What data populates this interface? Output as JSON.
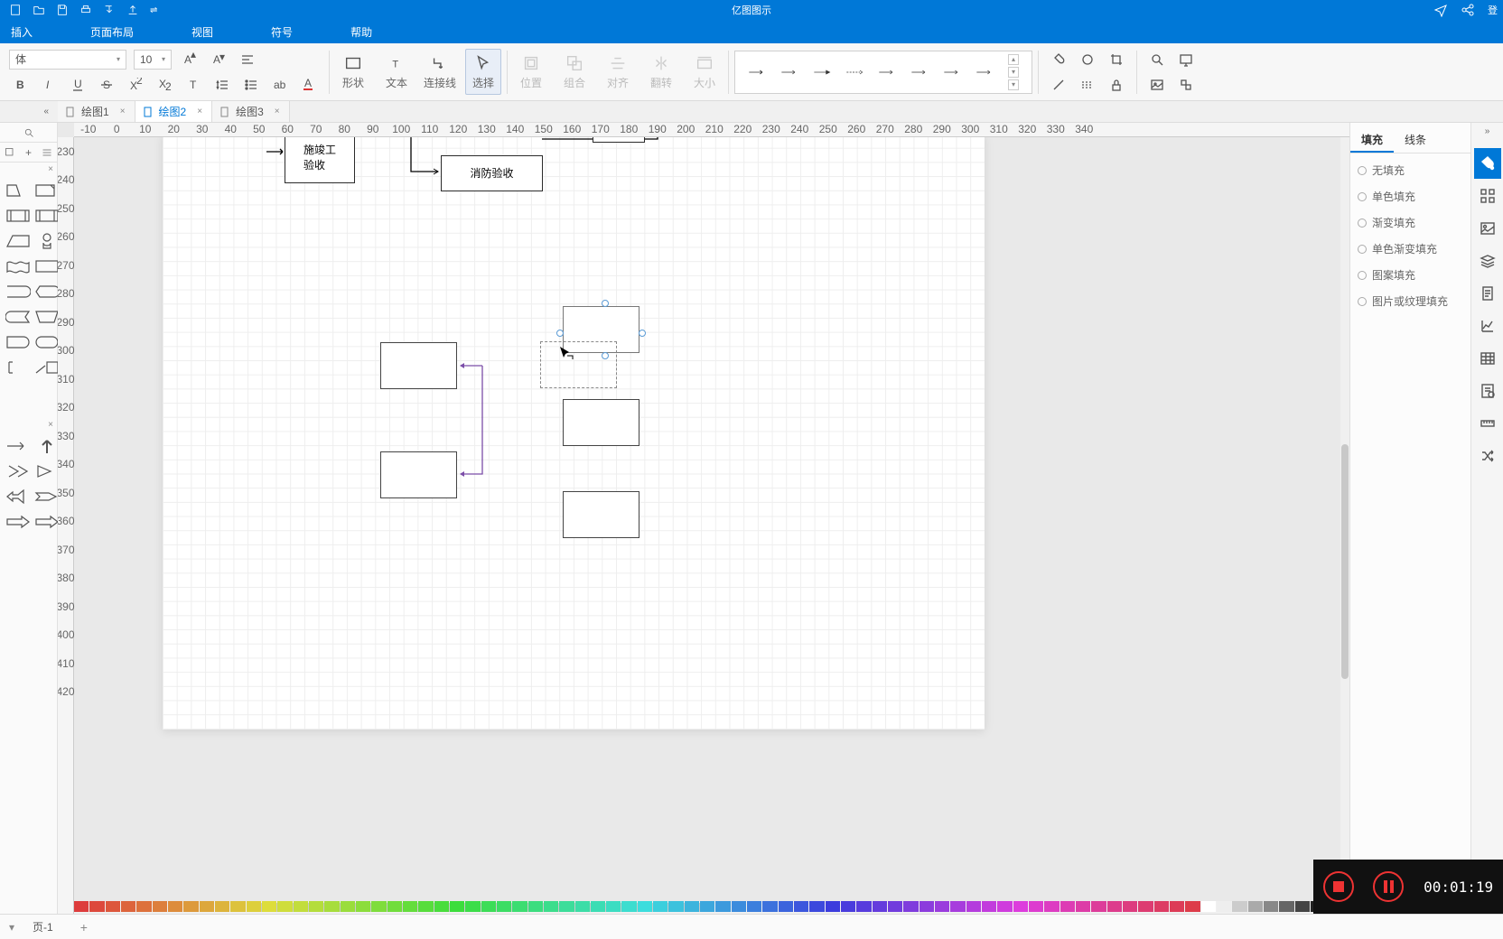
{
  "app": {
    "title": "亿图图示"
  },
  "menu": {
    "items": [
      "插入",
      "页面布局",
      "视图",
      "符号",
      "帮助"
    ],
    "login": "登"
  },
  "ribbon": {
    "font": "体",
    "size": "10",
    "group1": {
      "shape": "形状",
      "text": "文本",
      "connector": "连接线",
      "select": "选择"
    },
    "group2": {
      "position": "位置",
      "combine": "组合",
      "align": "对齐",
      "flip": "翻转",
      "size": "大小"
    }
  },
  "docTabs": [
    {
      "label": "绘图1",
      "active": false
    },
    {
      "label": "绘图2",
      "active": true
    },
    {
      "label": "绘图3",
      "active": false
    }
  ],
  "rulerH": [
    "-10",
    "0",
    "10",
    "20",
    "30",
    "40",
    "50",
    "60",
    "70",
    "80",
    "90",
    "100",
    "110",
    "120",
    "130",
    "140",
    "150",
    "160",
    "170",
    "180",
    "190",
    "200",
    "210",
    "220",
    "230",
    "240",
    "250",
    "260",
    "270",
    "280",
    "290",
    "300",
    "310",
    "320",
    "330",
    "340"
  ],
  "rulerV": [
    "230",
    "240",
    "250",
    "260",
    "270",
    "280",
    "290",
    "300",
    "310",
    "320",
    "330",
    "340",
    "350",
    "360",
    "370",
    "380",
    "390",
    "400",
    "410",
    "420"
  ],
  "shapes": {
    "box1": "施竣工\n验收",
    "box2": "消防验收"
  },
  "rightPanel": {
    "tabs": [
      "填充",
      "线条"
    ],
    "options": [
      "无填充",
      "单色填充",
      "渐变填充",
      "单色渐变填充",
      "图案填充",
      "图片或纹理填充"
    ]
  },
  "status": {
    "page": "页-1"
  },
  "recorder": {
    "time": "00:01:19"
  },
  "colors": [
    "#fff",
    "#000",
    "#7f7f7f",
    "#595959",
    "#d9d9d9",
    "#bfbfbf",
    "#a6a6a6",
    "#808080",
    "#c00000",
    "#ff0000",
    "#e97373",
    "#c55a5a",
    "#a04040",
    "#ed7d31",
    "#f4b183",
    "#c65911",
    "#ffc000",
    "#ffd966",
    "#bf8f00",
    "#ffff00",
    "#e2efda",
    "#a9d08e",
    "#548235",
    "#00b050",
    "#92d050",
    "#70ad47",
    "#00b0f0",
    "#9bc2e6",
    "#2f75b5",
    "#0070c0",
    "#1f4e78",
    "#002060",
    "#7030a0",
    "#b48dd3",
    "#ff66cc",
    "#ff99ff",
    "#999966",
    "#806000",
    "#996633",
    "#cc9900",
    "#c65911",
    "#833c0c",
    "#e7e6e6",
    "#d0cece",
    "#aeaaaa",
    "#757171",
    "#3a3838",
    "#000"
  ]
}
